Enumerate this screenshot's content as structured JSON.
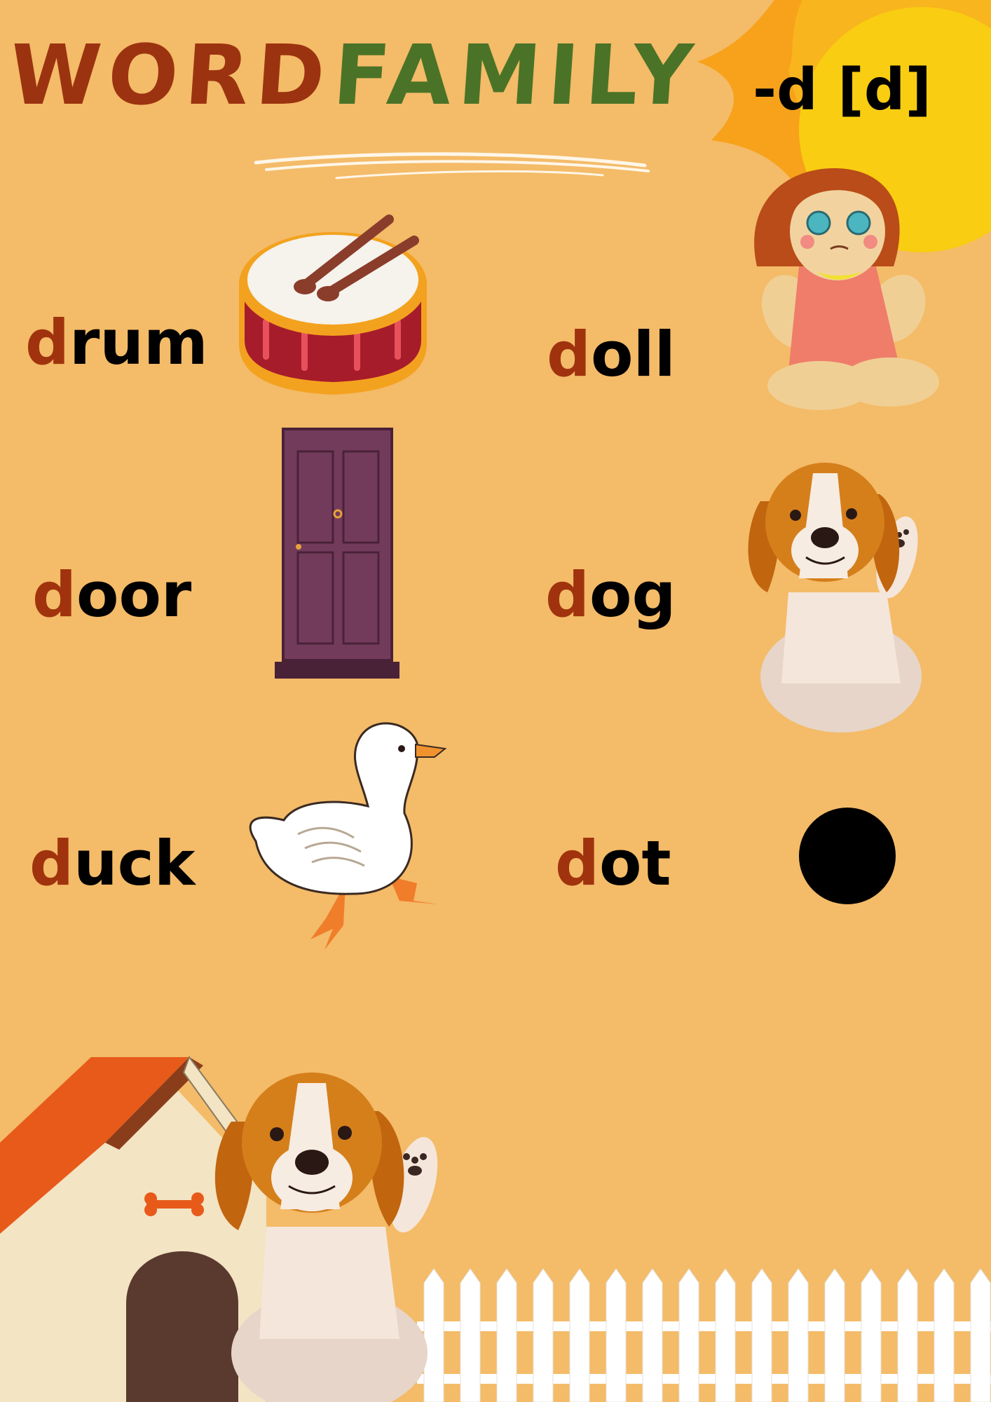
{
  "title": {
    "part1": "WORD",
    "part2": "FAMILY"
  },
  "sound": "-d [d]",
  "words": [
    {
      "first": "d",
      "rest": "rum",
      "icon": "drum-icon"
    },
    {
      "first": "d",
      "rest": "oll",
      "icon": "doll-icon"
    },
    {
      "first": "d",
      "rest": "oor",
      "icon": "door-icon"
    },
    {
      "first": "d",
      "rest": "og",
      "icon": "dog-icon"
    },
    {
      "first": "d",
      "rest": "uck",
      "icon": "duck-icon"
    },
    {
      "first": "d",
      "rest": "ot",
      "icon": "dot-icon"
    }
  ],
  "colors": {
    "background": "#f4bb68",
    "title_word": "#9c3310",
    "title_family": "#4a7327",
    "first_letter": "#a0330e",
    "sun": "#f9cd11"
  }
}
